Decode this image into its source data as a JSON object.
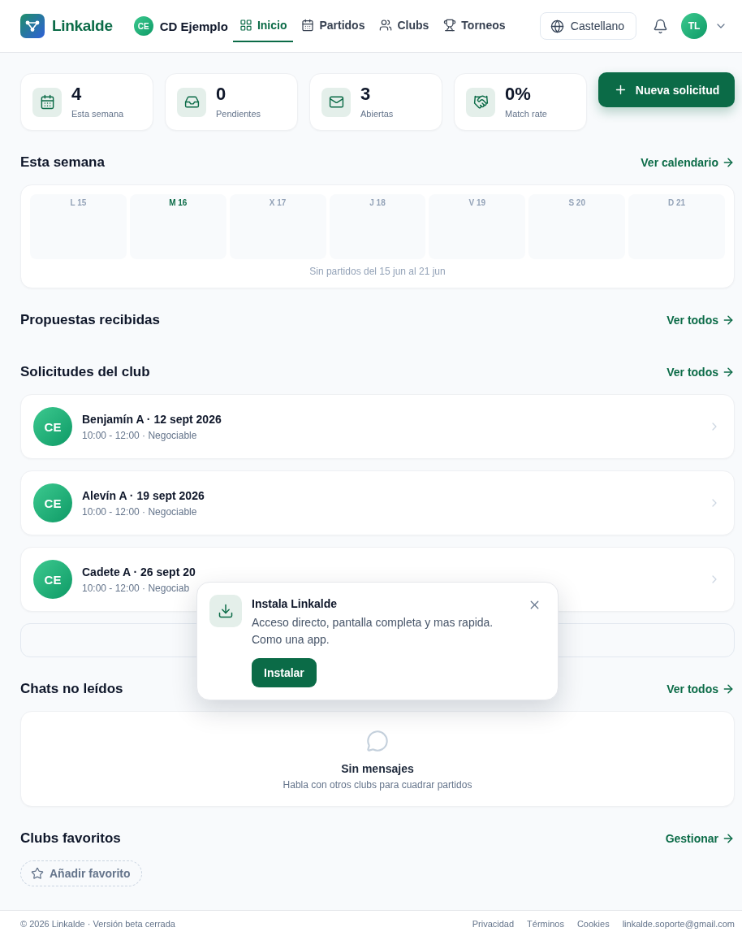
{
  "header": {
    "brand": "Linkalde",
    "club": {
      "initials": "CE",
      "name": "CD Ejemplo"
    },
    "nav": [
      {
        "label": "Inicio",
        "selected": true
      },
      {
        "label": "Partidos",
        "selected": false
      },
      {
        "label": "Clubs",
        "selected": false
      },
      {
        "label": "Torneos",
        "selected": false
      }
    ],
    "language": "Castellano",
    "user": {
      "initials": "TL"
    }
  },
  "stats": [
    {
      "value": "4",
      "label": "Esta semana"
    },
    {
      "value": "0",
      "label": "Pendientes"
    },
    {
      "value": "3",
      "label": "Abiertas"
    },
    {
      "value": "0%",
      "label": "Match rate"
    }
  ],
  "new_request_button": "Nueva solicitud",
  "week": {
    "title": "Esta semana",
    "link": "Ver calendario",
    "days": [
      {
        "label": "L 15",
        "today": false
      },
      {
        "label": "M 16",
        "today": true
      },
      {
        "label": "X 17",
        "today": false
      },
      {
        "label": "J 18",
        "today": false
      },
      {
        "label": "V 19",
        "today": false
      },
      {
        "label": "S 20",
        "today": false
      },
      {
        "label": "D 21",
        "today": false
      }
    ],
    "empty_text": "Sin partidos del 15 jun al 21 jun"
  },
  "proposals": {
    "title": "Propuestas recibidas",
    "link": "Ver todos"
  },
  "club_requests": {
    "title": "Solicitudes del club",
    "link": "Ver todos",
    "items": [
      {
        "initials": "CE",
        "title": "Benjamín A · 12 sept 2026",
        "details": "10:00 - 12:00 · Negociable"
      },
      {
        "initials": "CE",
        "title": "Alevín A · 19 sept 2026",
        "details": "10:00 - 12:00 · Negociable"
      },
      {
        "initials": "CE",
        "title": "Cadete A · 26 sept 20",
        "details": "10:00 - 12:00 · Negociab"
      }
    ]
  },
  "install_prompt": {
    "title": "Instala Linkalde",
    "text": "Acceso directo, pantalla completa y mas rapida. Como una app.",
    "button": "Instalar"
  },
  "unread_chats": {
    "title": "Chats no leídos",
    "link": "Ver todos",
    "empty_title": "Sin mensajes",
    "empty_text": "Habla con otros clubs para cuadrar partidos"
  },
  "favorite_clubs": {
    "title": "Clubs favoritos",
    "link": "Gestionar",
    "add_button": "Añadir favorito"
  },
  "footer": {
    "copyright": "© 2026 Linkalde · Versión beta cerrada",
    "links": [
      "Privacidad",
      "Términos",
      "Cookies",
      "linkalde.soporte@gmail.com"
    ]
  }
}
